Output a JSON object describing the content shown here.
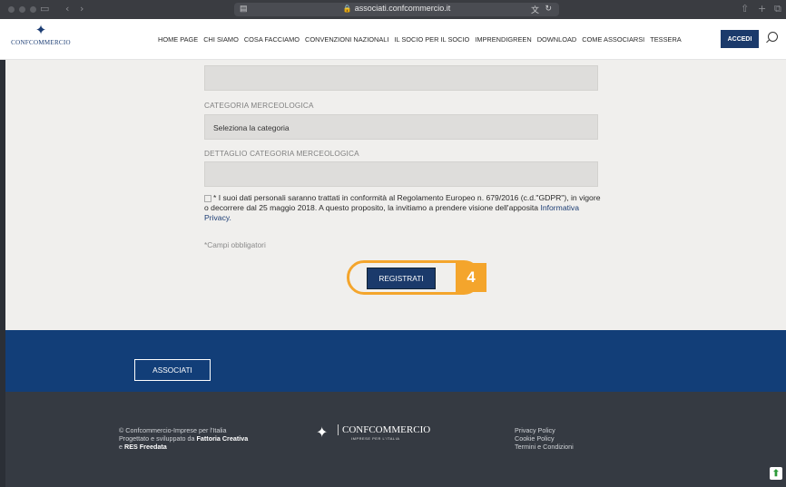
{
  "browser": {
    "url": "associati.confcommercio.it",
    "icons": [
      "sidebar-icon",
      "back-icon",
      "forward-icon",
      "share-icon",
      "new-tab-icon",
      "tabs-icon"
    ]
  },
  "nav": {
    "logo_text": "CONFCOMMERCIO",
    "menu": [
      "HOME PAGE",
      "CHI SIAMO",
      "COSA FACCIAMO",
      "CONVENZIONI NAZIONALI",
      "IL SOCIO PER IL SOCIO",
      "IMPRENDIGREEN",
      "DOWNLOAD",
      "COME ASSOCIARSI",
      "TESSERA"
    ],
    "accedi": "ACCEDI"
  },
  "form": {
    "categoria_label": "CATEGORIA MERCEOLOGICA",
    "categoria_value": "Seleziona la categoria",
    "dettaglio_label": "DETTAGLIO CATEGORIA MERCEOLOGICA",
    "consent_text": "* I suoi dati personali saranno trattati in conformità al Regolamento Europeo n. 679/2016 (c.d.\"GDPR\"), in vigore o decorrere dal 25 maggio 2018. A questo proposito, la invitiamo a prendere visione dell'apposita ",
    "consent_link": "Informativa Privacy.",
    "required_note": "*Campi obbligatori",
    "submit_label": "REGISTRATI",
    "step_badge": "4"
  },
  "band": {
    "button_label": "ASSOCIATI"
  },
  "footer": {
    "line1": "© Confcommercio-Imprese per l'Italia",
    "line2_prefix": "Progettato e sviluppato da ",
    "line2_bold": "Fattoria Creativa",
    "line3_prefix": "e ",
    "line3_bold": "RES Freedata",
    "logo_text": "CONFCOMMERCIO",
    "logo_sub": "IMPRESE PER L'ITALIA",
    "links": [
      "Privacy Policy",
      "Cookie Policy",
      "Termini e Condizioni"
    ]
  },
  "colors": {
    "brand": "#1b3a6b",
    "highlight": "#f4a52c",
    "band": "#123e78",
    "footer": "#353a42"
  }
}
